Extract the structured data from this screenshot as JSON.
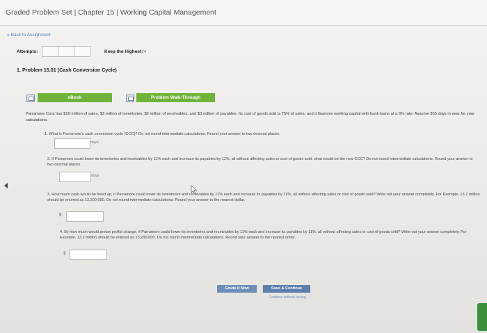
{
  "header": {
    "title": "Graded Problem Set | Chapter 15 | Working Capital Management"
  },
  "nav": {
    "back_label": "Back to Assignment"
  },
  "attempts": {
    "label": "Attempts:",
    "keep_highest_label": "Keep the Highest:",
    "keep_highest_value": "/4"
  },
  "problem": {
    "title": "1. Problem 15.01 (Cash Conversion Cycle)"
  },
  "tabs": {
    "ebook_label": "eBook",
    "walkthrough_label": "Problem Walk-Through"
  },
  "intro": "Parramore Corp has $10 million of sales, $3 million of inventories, $2 million of receivables, and $3 million of payables. Its cost of goods sold is 75% of sales, and it finances working capital with bank loans at a 6% rate. Assume 365 days in year for your calculations.",
  "questions": [
    {
      "text": "1. What is Parramore's cash conversion cycle (CCC)? Do not round intermediate calculations. Round your answer to two decimal places.",
      "unit": "days",
      "currency": ""
    },
    {
      "text": "2. If Parramore could lower its inventories and receivables by 11% each and increase its payables by 11%, all without affecting sales or cost of goods sold, what would be the new CCC? Do not round intermediate calculations. Round your answer to two decimal places.",
      "unit": "days",
      "currency": ""
    },
    {
      "text": "3. How much cash would be freed up, if Parramore could lower its inventories and receivables by 11% each and increase its payables by 11%, all without affecting sales or cost of goods sold? Write out your answer completely. For Example, 13.2 million should be entered as 13,200,000. Do not round intermediate calculations. Round your answer to the nearest dollar.",
      "unit": "",
      "currency": "$"
    },
    {
      "text": "4. By how much would pretax profits change, if Parramore could lower its inventories and receivables by 11% each and increase its payables by 11%, all without affecting sales or cost of goods sold? Write out your answer completely. For Example, 13.2 million should be entered as 13,200,000. Do not round intermediate calculations. Round your answer to the nearest dollar.",
      "unit": "",
      "currency": "$"
    }
  ],
  "footer": {
    "grade_label": "Grade It Now",
    "save_label": "Save & Continue",
    "continue_label": "Continue without saving"
  },
  "colors": {
    "green_button": "#6fb33a",
    "blue_button": "#6d8fb8",
    "link": "#4a79b8"
  }
}
